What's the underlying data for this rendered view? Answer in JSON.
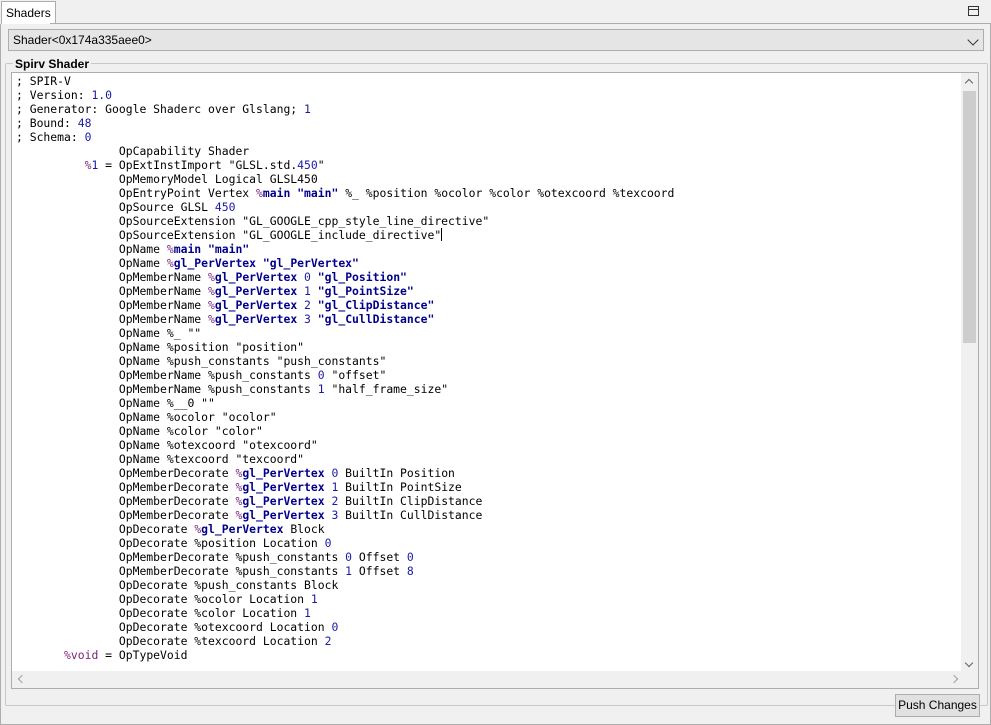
{
  "tab": {
    "label": "Shaders",
    "float_icon": "restore-window-icon"
  },
  "shader_select": {
    "value": "Shader<0x174a335aee0>",
    "arrow_icon": "chevron-down-icon"
  },
  "group": {
    "title": "Spirv Shader"
  },
  "code_lines": [
    [
      [
        "t",
        "; SPIR-V"
      ]
    ],
    [
      [
        "t",
        "; Version: "
      ],
      [
        "n",
        "1.0"
      ]
    ],
    [
      [
        "t",
        "; Generator: Google Shaderc over Glslang; "
      ],
      [
        "n",
        "1"
      ]
    ],
    [
      [
        "t",
        "; Bound: "
      ],
      [
        "n",
        "48"
      ]
    ],
    [
      [
        "t",
        "; Schema: "
      ],
      [
        "n",
        "0"
      ]
    ],
    [
      [
        "t",
        "               OpCapability Shader"
      ]
    ],
    [
      [
        "t",
        "          "
      ],
      [
        "v",
        "%"
      ],
      [
        "n",
        "1"
      ],
      [
        "t",
        " = OpExtInstImport \"GLSL.std."
      ],
      [
        "n",
        "450"
      ],
      [
        "t",
        "\""
      ]
    ],
    [
      [
        "t",
        "               OpMemoryModel Logical GLSL450"
      ]
    ],
    [
      [
        "t",
        "               OpEntryPoint Vertex "
      ],
      [
        "v",
        "%"
      ],
      [
        "b",
        "main"
      ],
      [
        "t",
        " "
      ],
      [
        "b",
        "\"main\""
      ],
      [
        "t",
        " %_ %position %ocolor %color %otexcoord %texcoord"
      ]
    ],
    [
      [
        "t",
        "               OpSource GLSL "
      ],
      [
        "n",
        "450"
      ]
    ],
    [
      [
        "t",
        "               OpSourceExtension \"GL_GOOGLE_cpp_style_line_directive\""
      ]
    ],
    [
      [
        "t",
        "               OpSourceExtension \"GL_GOOGLE_include_directive\""
      ],
      [
        "caret",
        ""
      ]
    ],
    [
      [
        "t",
        "               OpName "
      ],
      [
        "v",
        "%"
      ],
      [
        "b",
        "main"
      ],
      [
        "t",
        " "
      ],
      [
        "b",
        "\"main\""
      ]
    ],
    [
      [
        "t",
        "               OpName "
      ],
      [
        "v",
        "%"
      ],
      [
        "b",
        "gl_PerVertex"
      ],
      [
        "t",
        " "
      ],
      [
        "b",
        "\"gl_PerVertex\""
      ]
    ],
    [
      [
        "t",
        "               OpMemberName "
      ],
      [
        "v",
        "%"
      ],
      [
        "b",
        "gl_PerVertex"
      ],
      [
        "t",
        " "
      ],
      [
        "n",
        "0"
      ],
      [
        "t",
        " "
      ],
      [
        "b",
        "\"gl_Position\""
      ]
    ],
    [
      [
        "t",
        "               OpMemberName "
      ],
      [
        "v",
        "%"
      ],
      [
        "b",
        "gl_PerVertex"
      ],
      [
        "t",
        " "
      ],
      [
        "n",
        "1"
      ],
      [
        "t",
        " "
      ],
      [
        "b",
        "\"gl_PointSize\""
      ]
    ],
    [
      [
        "t",
        "               OpMemberName "
      ],
      [
        "v",
        "%"
      ],
      [
        "b",
        "gl_PerVertex"
      ],
      [
        "t",
        " "
      ],
      [
        "n",
        "2"
      ],
      [
        "t",
        " "
      ],
      [
        "b",
        "\"gl_ClipDistance\""
      ]
    ],
    [
      [
        "t",
        "               OpMemberName "
      ],
      [
        "v",
        "%"
      ],
      [
        "b",
        "gl_PerVertex"
      ],
      [
        "t",
        " "
      ],
      [
        "n",
        "3"
      ],
      [
        "t",
        " "
      ],
      [
        "b",
        "\"gl_CullDistance\""
      ]
    ],
    [
      [
        "t",
        "               OpName %_ \"\""
      ]
    ],
    [
      [
        "t",
        "               OpName %position \"position\""
      ]
    ],
    [
      [
        "t",
        "               OpName %push_constants \"push_constants\""
      ]
    ],
    [
      [
        "t",
        "               OpMemberName %push_constants "
      ],
      [
        "n",
        "0"
      ],
      [
        "t",
        " \"offset\""
      ]
    ],
    [
      [
        "t",
        "               OpMemberName %push_constants "
      ],
      [
        "n",
        "1"
      ],
      [
        "t",
        " \"half_frame_size\""
      ]
    ],
    [
      [
        "t",
        "               OpName %__0 \"\""
      ]
    ],
    [
      [
        "t",
        "               OpName %ocolor \"ocolor\""
      ]
    ],
    [
      [
        "t",
        "               OpName %color \"color\""
      ]
    ],
    [
      [
        "t",
        "               OpName %otexcoord \"otexcoord\""
      ]
    ],
    [
      [
        "t",
        "               OpName %texcoord \"texcoord\""
      ]
    ],
    [
      [
        "t",
        "               OpMemberDecorate "
      ],
      [
        "v",
        "%"
      ],
      [
        "b",
        "gl_PerVertex"
      ],
      [
        "t",
        " "
      ],
      [
        "n",
        "0"
      ],
      [
        "t",
        " BuiltIn Position"
      ]
    ],
    [
      [
        "t",
        "               OpMemberDecorate "
      ],
      [
        "v",
        "%"
      ],
      [
        "b",
        "gl_PerVertex"
      ],
      [
        "t",
        " "
      ],
      [
        "n",
        "1"
      ],
      [
        "t",
        " BuiltIn PointSize"
      ]
    ],
    [
      [
        "t",
        "               OpMemberDecorate "
      ],
      [
        "v",
        "%"
      ],
      [
        "b",
        "gl_PerVertex"
      ],
      [
        "t",
        " "
      ],
      [
        "n",
        "2"
      ],
      [
        "t",
        " BuiltIn ClipDistance"
      ]
    ],
    [
      [
        "t",
        "               OpMemberDecorate "
      ],
      [
        "v",
        "%"
      ],
      [
        "b",
        "gl_PerVertex"
      ],
      [
        "t",
        " "
      ],
      [
        "n",
        "3"
      ],
      [
        "t",
        " BuiltIn CullDistance"
      ]
    ],
    [
      [
        "t",
        "               OpDecorate "
      ],
      [
        "v",
        "%"
      ],
      [
        "b",
        "gl_PerVertex"
      ],
      [
        "t",
        " Block"
      ]
    ],
    [
      [
        "t",
        "               OpDecorate %position Location "
      ],
      [
        "n",
        "0"
      ]
    ],
    [
      [
        "t",
        "               OpMemberDecorate %push_constants "
      ],
      [
        "n",
        "0"
      ],
      [
        "t",
        " Offset "
      ],
      [
        "n",
        "0"
      ]
    ],
    [
      [
        "t",
        "               OpMemberDecorate %push_constants "
      ],
      [
        "n",
        "1"
      ],
      [
        "t",
        " Offset "
      ],
      [
        "n",
        "8"
      ]
    ],
    [
      [
        "t",
        "               OpDecorate %push_constants Block"
      ]
    ],
    [
      [
        "t",
        "               OpDecorate %ocolor Location "
      ],
      [
        "n",
        "1"
      ]
    ],
    [
      [
        "t",
        "               OpDecorate %color Location "
      ],
      [
        "n",
        "1"
      ]
    ],
    [
      [
        "t",
        "               OpDecorate %otexcoord Location "
      ],
      [
        "n",
        "0"
      ]
    ],
    [
      [
        "t",
        "               OpDecorate %texcoord Location "
      ],
      [
        "n",
        "2"
      ]
    ],
    [
      [
        "t",
        "       "
      ],
      [
        "v",
        "%void"
      ],
      [
        "t",
        " = OpTypeVoid"
      ]
    ]
  ],
  "scrollbar": {
    "up_icon": "arrow-up-icon",
    "down_icon": "arrow-down-icon",
    "left_icon": "arrow-left-icon",
    "right_icon": "arrow-right-icon"
  },
  "push_button": {
    "label": "Push Changes"
  }
}
